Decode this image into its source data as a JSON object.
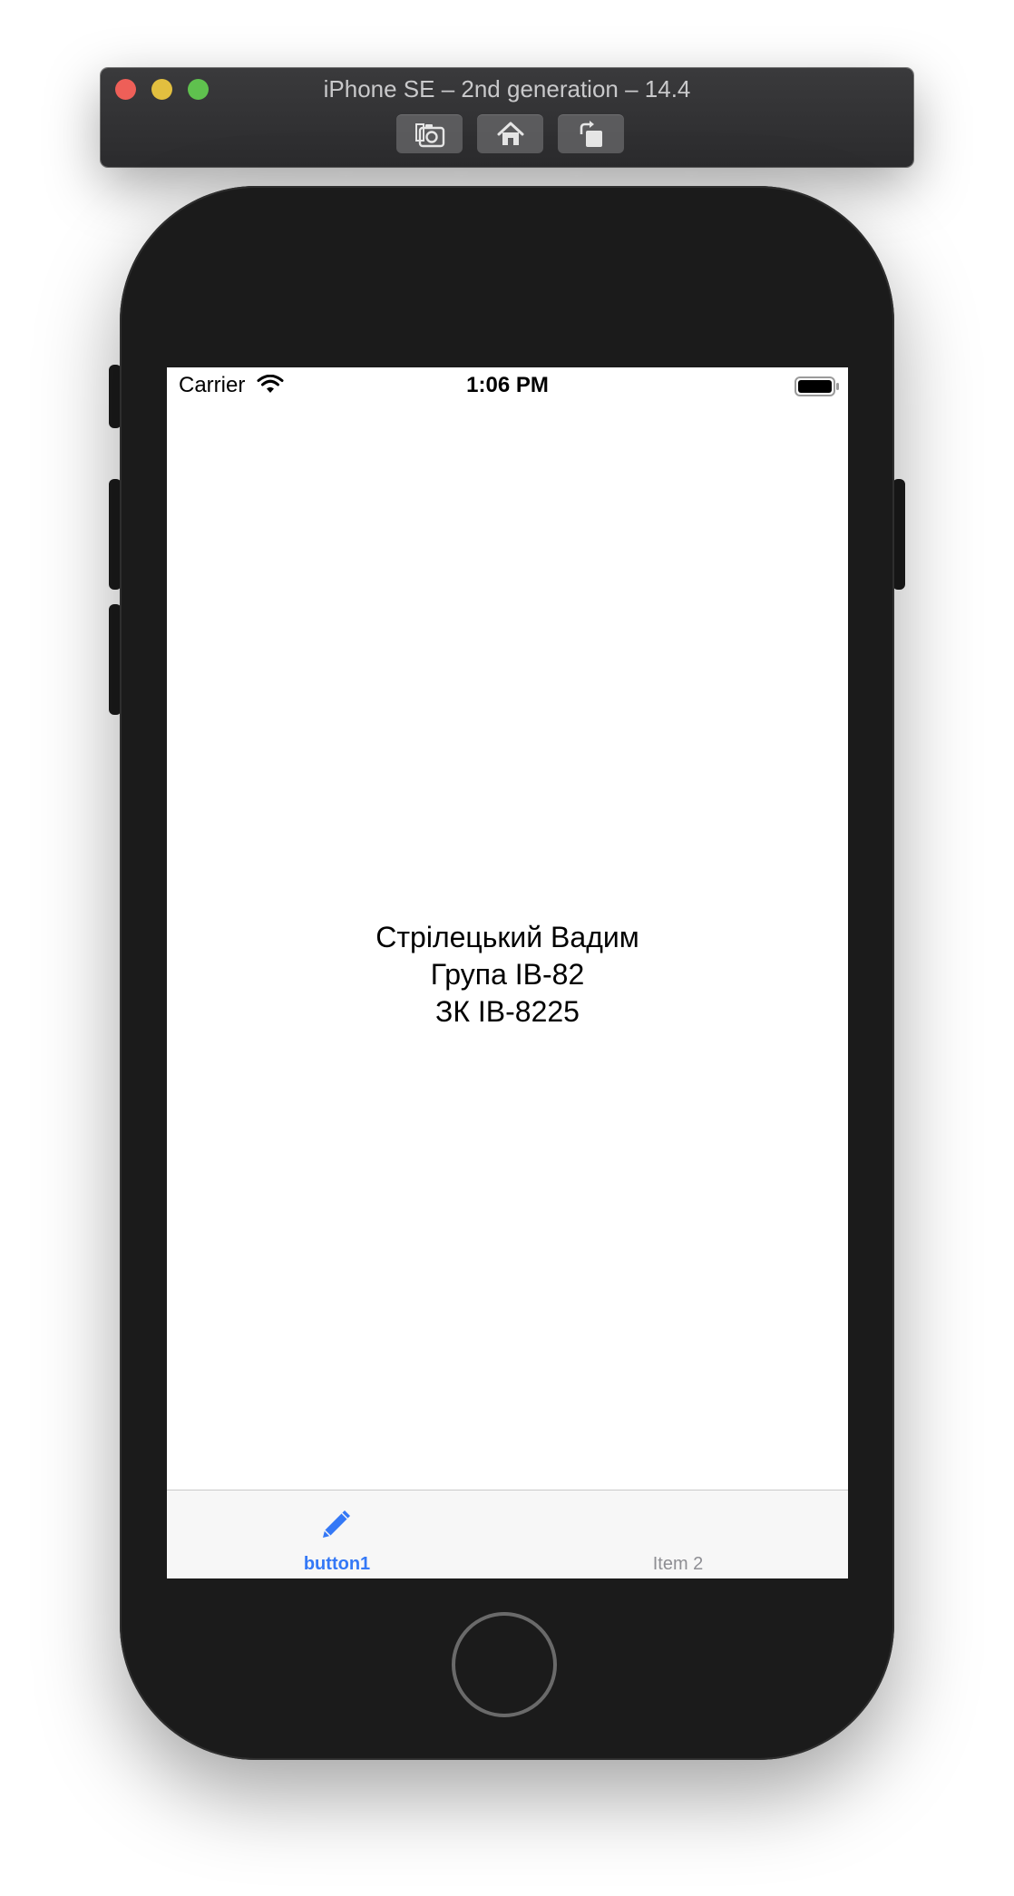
{
  "window": {
    "title": "iPhone SE – 2nd generation – 14.4",
    "toolbar": {
      "screenshot_icon": "camera-icon",
      "home_icon": "home-icon",
      "rotate_icon": "rotate-icon"
    }
  },
  "status_bar": {
    "carrier": "Carrier",
    "time": "1:06 PM",
    "wifi_icon": "wifi-icon",
    "battery_icon": "battery-icon"
  },
  "content": {
    "line1": "Стрілецький Вадим",
    "line2": "Група ІВ-82",
    "line3": "ЗК ІВ-8225"
  },
  "tab_bar": {
    "items": [
      {
        "label": "button1",
        "icon": "pencil-icon",
        "selected": true
      },
      {
        "label": "Item 2",
        "icon": "",
        "selected": false
      }
    ]
  },
  "colors": {
    "tint": "#3478f6",
    "inactive": "#8e8e93",
    "device": "#1b1b1b"
  }
}
